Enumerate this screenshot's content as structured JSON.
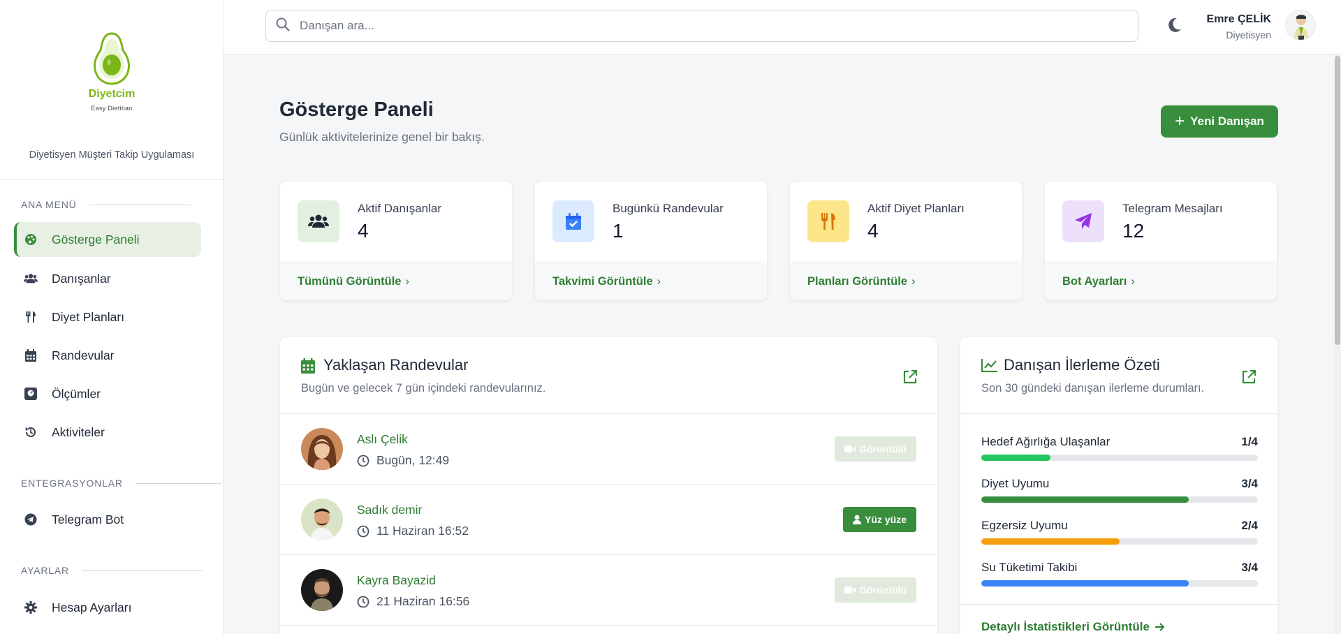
{
  "brand": {
    "name": "Diyetcim",
    "tagline": "Easy Dietitian",
    "description": "Diyetisyen Müşteri Takip Uygulaması",
    "color": "#7cb518"
  },
  "sidebar": {
    "sections": [
      {
        "label": "ANA MENÜ"
      },
      {
        "label": "ENTEGRASYONLAR"
      },
      {
        "label": "AYARLAR"
      }
    ],
    "items": [
      {
        "label": "Gösterge Paneli",
        "icon": "palette-icon",
        "active": true
      },
      {
        "label": "Danışanlar",
        "icon": "users-icon"
      },
      {
        "label": "Diyet Planları",
        "icon": "utensils-icon"
      },
      {
        "label": "Randevular",
        "icon": "calendar-icon"
      },
      {
        "label": "Ölçümler",
        "icon": "weight-scale-icon"
      },
      {
        "label": "Aktiviteler",
        "icon": "history-icon"
      },
      {
        "label": "Telegram Bot",
        "icon": "telegram-icon"
      },
      {
        "label": "Hesap Ayarları",
        "icon": "gear-icon"
      }
    ]
  },
  "header": {
    "search_placeholder": "Danışan ara...",
    "user_name": "Emre ÇELİK",
    "user_role": "Diyetisyen"
  },
  "page": {
    "title": "Gösterge Paneli",
    "subtitle": "Günlük aktivitelerinize genel bir bakış.",
    "new_client_label": "Yeni Danışan"
  },
  "stats": [
    {
      "label": "Aktif Danışanlar",
      "value": "4",
      "link": "Tümünü Görüntüle",
      "icon": "users-icon",
      "bg": "#e3efe1",
      "fg": "#1f2937"
    },
    {
      "label": "Bugünkü Randevular",
      "value": "1",
      "link": "Takvimi Görüntüle",
      "icon": "calendar-check-icon",
      "bg": "#dbeafe",
      "fg": "#3b82f6"
    },
    {
      "label": "Aktif Diyet Planları",
      "value": "4",
      "link": "Planları Görüntüle",
      "icon": "utensils-icon",
      "bg": "#fde68a",
      "fg": "#d97706"
    },
    {
      "label": "Telegram Mesajları",
      "value": "12",
      "link": "Bot Ayarları",
      "icon": "paper-plane-icon",
      "bg": "#ede0fb",
      "fg": "#9333ea"
    }
  ],
  "appointments": {
    "title": "Yaklaşan Randevular",
    "subtitle": "Bugün ve gelecek 7 gün içindeki randevularınız.",
    "items": [
      {
        "name": "Aslı Çelik",
        "time": "Bugün, 12:49",
        "type": "Görüntülü",
        "kind": "video"
      },
      {
        "name": "Sadık demir",
        "time": "11 Haziran 16:52",
        "type": "Yüz yüze",
        "kind": "face"
      },
      {
        "name": "Kayra Bayazid",
        "time": "21 Haziran 16:56",
        "type": "Görüntülü",
        "kind": "video"
      }
    ]
  },
  "progress": {
    "title": "Danışan İlerleme Özeti",
    "subtitle": "Son 30 gündeki danışan ilerleme durumları.",
    "items": [
      {
        "label": "Hedef Ağırlığa Ulaşanlar",
        "value": "1/4",
        "fraction": 0.25,
        "color": "#22c55e"
      },
      {
        "label": "Diyet Uyumu",
        "value": "3/4",
        "fraction": 0.75,
        "color": "#388e3c"
      },
      {
        "label": "Egzersiz Uyumu",
        "value": "2/4",
        "fraction": 0.5,
        "color": "#f59e0b"
      },
      {
        "label": "Su Tüketimi Takibi",
        "value": "3/4",
        "fraction": 0.75,
        "color": "#3b82f6"
      }
    ],
    "detail_link": "Detaylı İstatistikleri Görüntüle"
  }
}
